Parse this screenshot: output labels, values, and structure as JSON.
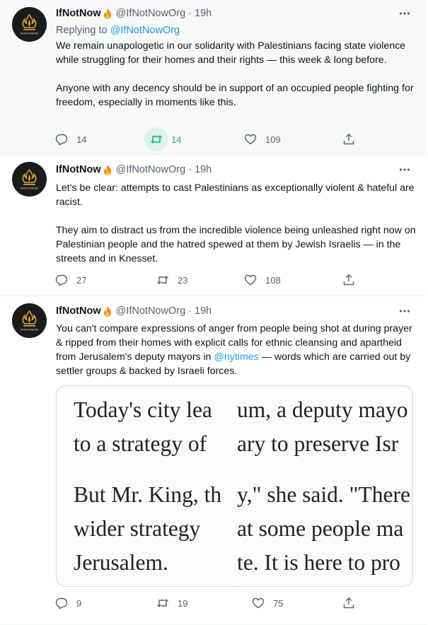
{
  "colors": {
    "accent": "#1d9bf0",
    "retweet_green": "#00ba7c",
    "muted": "#536471"
  },
  "tweets": [
    {
      "name": "IfNotNow",
      "name_emoji": "fire-icon",
      "handle": "@IfNotNowOrg",
      "time": "19h",
      "replying_to_label": "Replying to",
      "replying_to_mention": "@IfNotNowOrg",
      "paragraphs": [
        "We remain unapologetic in our solidarity with Palestinians facing state violence while struggling for their homes and their rights — this week & long before.",
        "Anyone with any decency should be in support of an occupied people fighting for freedom, especially in moments like this."
      ],
      "replies": "14",
      "retweets": "14",
      "retweeted": true,
      "likes": "109"
    },
    {
      "name": "IfNotNow",
      "name_emoji": "fire-icon",
      "handle": "@IfNotNowOrg",
      "time": "19h",
      "paragraphs": [
        "Let's be clear: attempts to cast Palestinians as exceptionally violent & hateful are racist.",
        "They aim to distract us from the incredible violence being unleashed right now on Palestinian people and the hatred spewed at them by Jewish Israelis — in the streets and in Knesset."
      ],
      "replies": "27",
      "retweets": "23",
      "likes": "108"
    },
    {
      "name": "IfNotNow",
      "name_emoji": "fire-icon",
      "handle": "@IfNotNowOrg",
      "time": "19h",
      "text_before_mention": "You can't compare expressions of anger from people being shot at during prayer & ripped from their homes with explicit calls for ethnic cleansing and apartheid from Jerusalem's deputy mayors in ",
      "mention": "@nytimes",
      "text_after_mention": " — words which are carried out by settler groups & backed by Israeli forces.",
      "media": {
        "left_lines": [
          "Today's city lea",
          "to a strategy of",
          "But Mr. King, th",
          "wider strategy",
          "Jerusalem."
        ],
        "right_lines": [
          "um, a deputy mayo",
          "ary to preserve Isr",
          "y,\" she said. \"There",
          "at some people ma",
          "te. It is here to pro"
        ]
      },
      "replies": "9",
      "retweets": "19",
      "likes": "75"
    }
  ]
}
